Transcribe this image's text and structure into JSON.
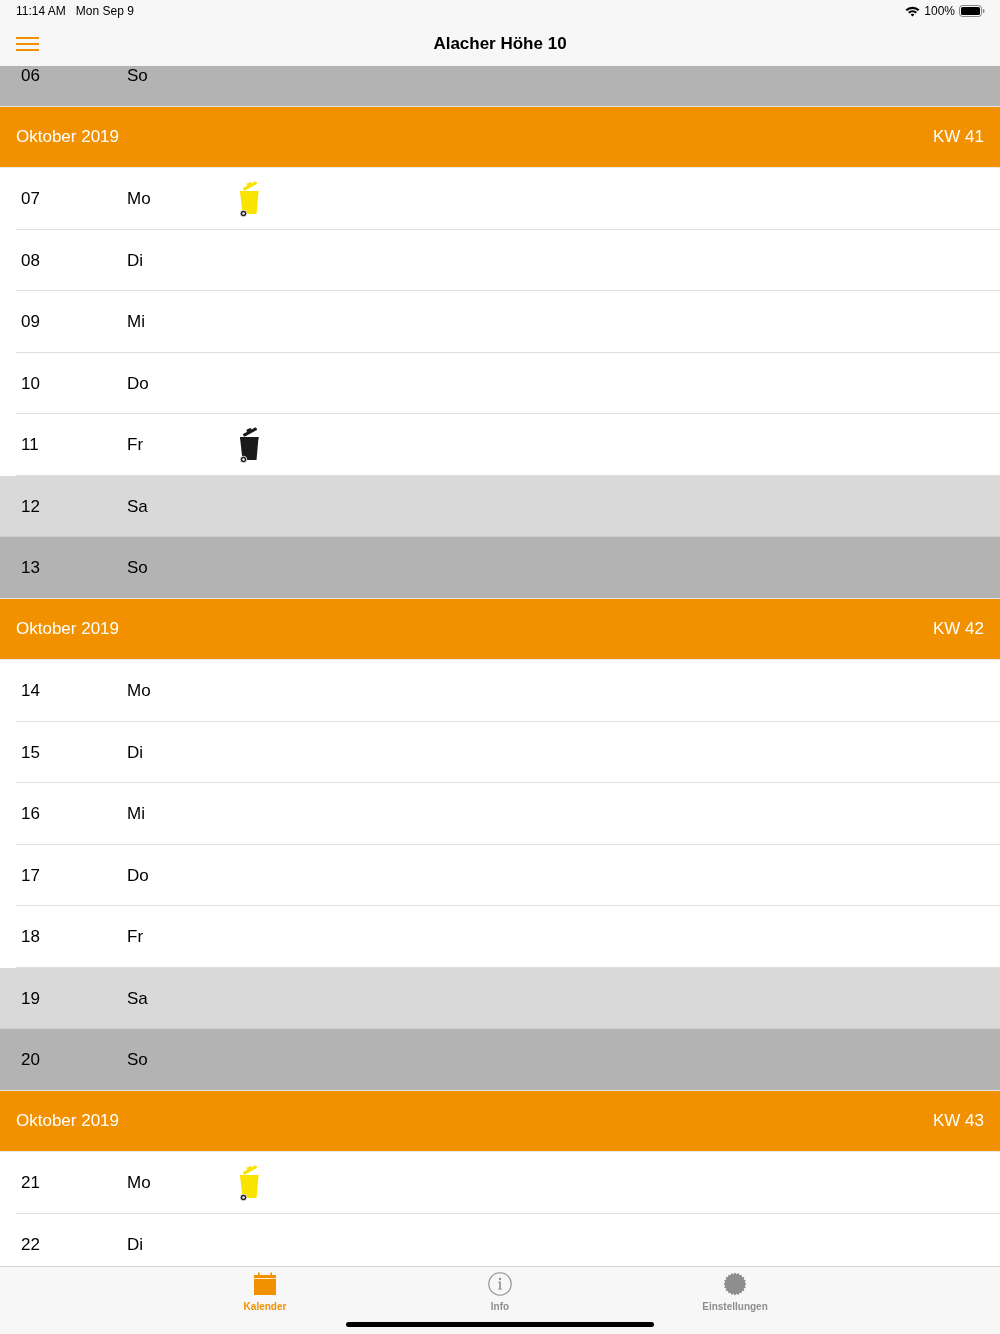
{
  "status_bar": {
    "time": "11:14 AM",
    "date": "Mon Sep 9",
    "battery": "100%"
  },
  "nav_bar": {
    "title": "Alacher Höhe 10"
  },
  "calendar": [
    {
      "kind": "sunday",
      "day": "06",
      "weekday": "So"
    },
    {
      "kind": "header",
      "month": "Oktober 2019",
      "week": "KW 41"
    },
    {
      "kind": "weekday",
      "day": "07",
      "weekday": "Mo",
      "bins": [
        {
          "color": "#f8e400"
        }
      ]
    },
    {
      "kind": "weekday",
      "day": "08",
      "weekday": "Di"
    },
    {
      "kind": "weekday",
      "day": "09",
      "weekday": "Mi"
    },
    {
      "kind": "weekday",
      "day": "10",
      "weekday": "Do"
    },
    {
      "kind": "weekday",
      "day": "11",
      "weekday": "Fr",
      "bins": [
        {
          "color": "#1a1a1a"
        }
      ]
    },
    {
      "kind": "saturday",
      "day": "12",
      "weekday": "Sa"
    },
    {
      "kind": "sunday",
      "day": "13",
      "weekday": "So"
    },
    {
      "kind": "header",
      "month": "Oktober 2019",
      "week": "KW 42"
    },
    {
      "kind": "weekday",
      "day": "14",
      "weekday": "Mo"
    },
    {
      "kind": "weekday",
      "day": "15",
      "weekday": "Di"
    },
    {
      "kind": "weekday",
      "day": "16",
      "weekday": "Mi"
    },
    {
      "kind": "weekday",
      "day": "17",
      "weekday": "Do"
    },
    {
      "kind": "weekday",
      "day": "18",
      "weekday": "Fr"
    },
    {
      "kind": "saturday",
      "day": "19",
      "weekday": "Sa"
    },
    {
      "kind": "sunday",
      "day": "20",
      "weekday": "So"
    },
    {
      "kind": "header",
      "month": "Oktober 2019",
      "week": "KW 43"
    },
    {
      "kind": "weekday",
      "day": "21",
      "weekday": "Mo",
      "bins": [
        {
          "color": "#f8e400"
        }
      ]
    },
    {
      "kind": "weekday",
      "day": "22",
      "weekday": "Di"
    }
  ],
  "tabs": [
    {
      "kind": "calendar",
      "label": "Kalender",
      "selected": true
    },
    {
      "kind": "info",
      "label": "Info",
      "selected": false
    },
    {
      "kind": "settings",
      "label": "Einstellungen",
      "selected": false
    }
  ]
}
